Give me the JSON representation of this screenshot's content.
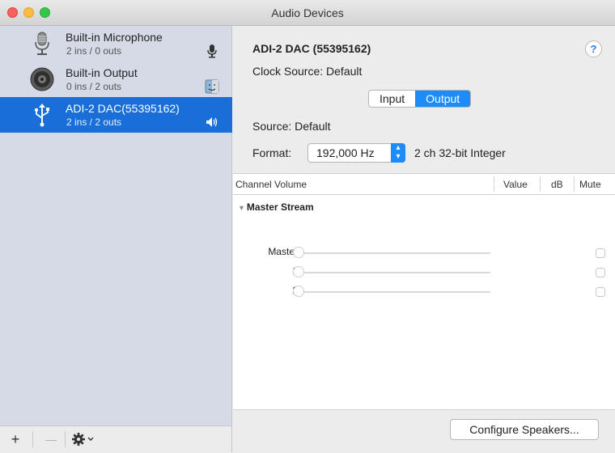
{
  "window": {
    "title": "Audio Devices"
  },
  "sidebar": {
    "devices": [
      {
        "name": "Built-in Microphone",
        "io": "2 ins / 0 outs",
        "icon": "microphone-icon",
        "badge": "microphone-badge-icon"
      },
      {
        "name": "Built-in Output",
        "io": "0 ins / 2 outs",
        "icon": "speaker-icon",
        "badge": "finder-badge-icon"
      },
      {
        "name": "ADI-2 DAC(55395162)",
        "io": "2 ins / 2 outs",
        "icon": "usb-icon",
        "badge": "speaker-badge-icon",
        "selected": true
      }
    ],
    "toolbar": {
      "add": "+",
      "remove": "—",
      "action": "gear-icon"
    }
  },
  "detail": {
    "device_title": "ADI-2 DAC (55395162)",
    "help": "?",
    "clock_source": "Clock Source:  Default",
    "tabs": [
      "Input",
      "Output"
    ],
    "active_tab": "Output",
    "source": "Source:  Default",
    "format_label": "Format:",
    "format_value": "192,000 Hz",
    "format_desc": "2 ch 32-bit Integer",
    "table": {
      "headers": {
        "channel": "Channel Volume",
        "value": "Value",
        "db": "dB",
        "mute": "Mute"
      },
      "group": "Master Stream",
      "rows": [
        {
          "label": "Master",
          "volume": 0
        },
        {
          "label": "1",
          "volume": 0
        },
        {
          "label": "2",
          "volume": 0
        }
      ]
    },
    "configure_button": "Configure Speakers..."
  },
  "colors": {
    "accent": "#1e8cf8",
    "selection": "#1a6ed8",
    "sidebar": "#d5dae6"
  }
}
